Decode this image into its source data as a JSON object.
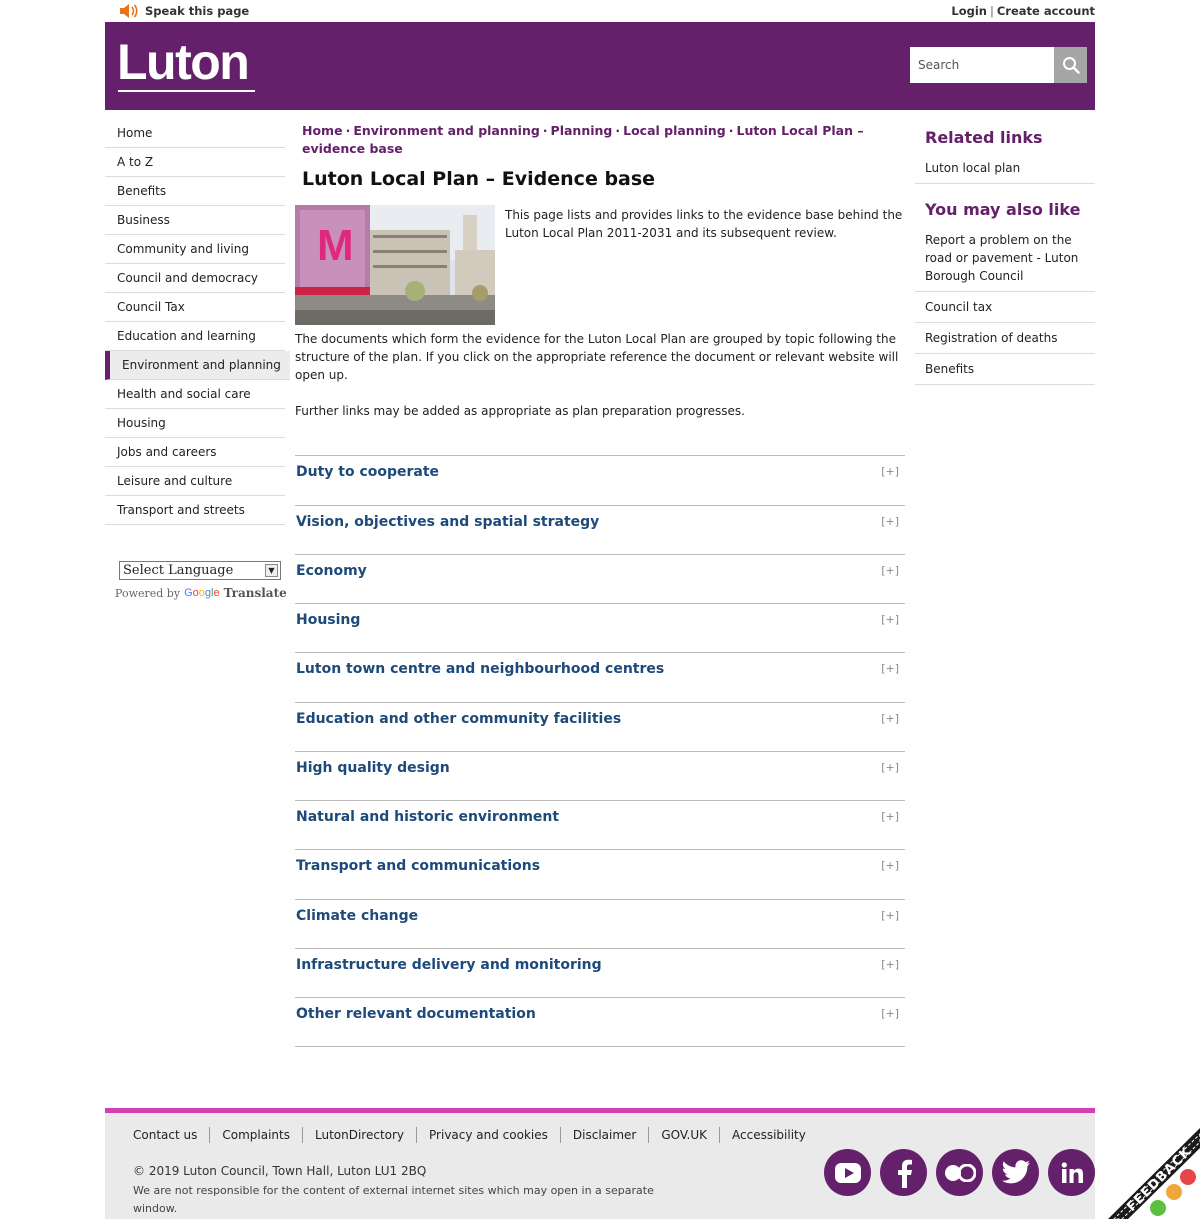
{
  "topbar": {
    "speak_label": "Speak this page",
    "login": "Login",
    "separator": "|",
    "create_account": "Create account"
  },
  "header": {
    "logo_text": "Luton",
    "search_placeholder": "Search"
  },
  "nav": {
    "items": [
      "Home",
      "A to Z",
      "Benefits",
      "Business",
      "Community and living",
      "Council and democracy",
      "Council Tax",
      "Education and learning",
      "Environment and planning",
      "Health and social care",
      "Housing",
      "Jobs and careers",
      "Leisure and culture",
      "Transport and streets"
    ],
    "active_index": 8
  },
  "translate": {
    "select_label": "Select Language",
    "powered_by": "Powered by",
    "google": "Google",
    "translate": "Translate"
  },
  "breadcrumb": {
    "items": [
      "Home",
      "Environment and planning",
      "Planning",
      "Local planning",
      "Luton Local Plan – evidence base"
    ],
    "separator": "·"
  },
  "main": {
    "title": "Luton Local Plan – Evidence base",
    "intro": "This page lists and provides links to the evidence base behind the Luton Local Plan 2011-2031 and its subsequent review.",
    "para1": "The documents which form the evidence for the Luton Local Plan are grouped by topic following the structure of the plan. If you click on the appropriate reference the document or relevant website will open up.",
    "para2": "Further links may be added as appropriate as plan preparation progresses.",
    "hero_letter": "M"
  },
  "accordion": {
    "toggle_label": "[+]",
    "items": [
      "Duty to cooperate",
      "Vision, objectives and spatial strategy",
      "Economy",
      "Housing",
      "Luton town centre and neighbourhood centres",
      "Education and other community facilities",
      "High quality design",
      "Natural and historic environment",
      "Transport and communications",
      "Climate change",
      "Infrastructure delivery and monitoring",
      "Other relevant documentation"
    ]
  },
  "related": {
    "heading": "Related links",
    "links": [
      "Luton local plan"
    ],
    "also_heading": "You may also like",
    "also_links": [
      "Report a problem on the road or pavement - Luton Borough Council",
      "Council tax",
      "Registration of deaths",
      "Benefits"
    ]
  },
  "footer": {
    "links": [
      "Contact us",
      "Complaints",
      "LutonDirectory",
      "Privacy and cookies",
      "Disclaimer",
      "GOV.UK",
      "Accessibility"
    ],
    "copyright": "© 2019 Luton Council, Town Hall, Luton LU1 2BQ",
    "disclaimer": "We are not responsible for the content of external internet sites which may open in a separate window.",
    "socials": [
      "youtube-icon",
      "facebook-icon",
      "flickr-icon",
      "twitter-icon",
      "linkedin-icon"
    ]
  },
  "feedback_tab": "FEEDBACK",
  "colors": {
    "brand": "#64206a",
    "accent_pink": "#d43fb5",
    "link_blue": "#1d4a7a"
  }
}
